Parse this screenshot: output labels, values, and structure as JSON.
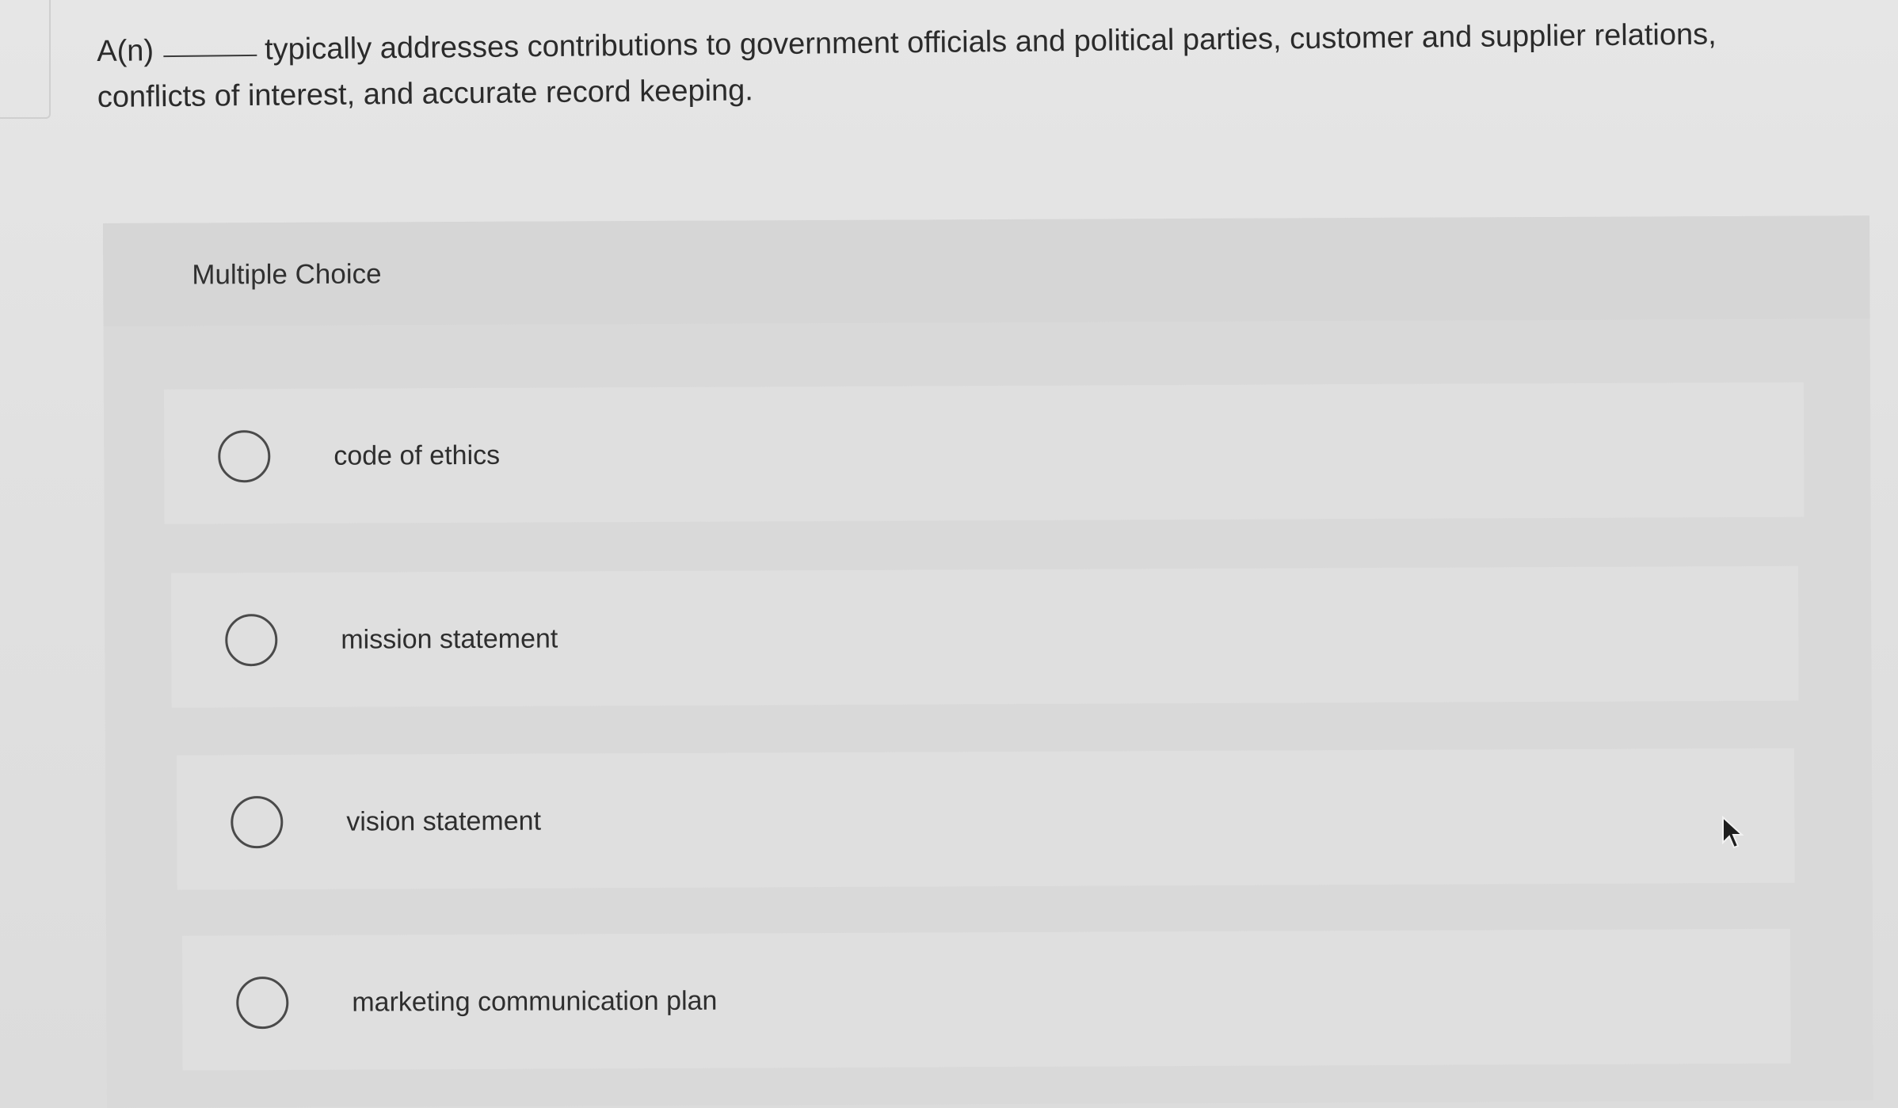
{
  "question": {
    "prefix": "A(n)",
    "text": "typically addresses contributions to government officials and political parties, customer and supplier relations, conflicts of interest, and accurate record keeping."
  },
  "multiple_choice": {
    "label": "Multiple Choice",
    "options": [
      {
        "label": "code of ethics"
      },
      {
        "label": "mission statement"
      },
      {
        "label": "vision statement"
      },
      {
        "label": "marketing communication plan"
      }
    ]
  },
  "icons": {
    "radio": "radio-unselected-icon",
    "cursor": "mouse-pointer-icon"
  }
}
